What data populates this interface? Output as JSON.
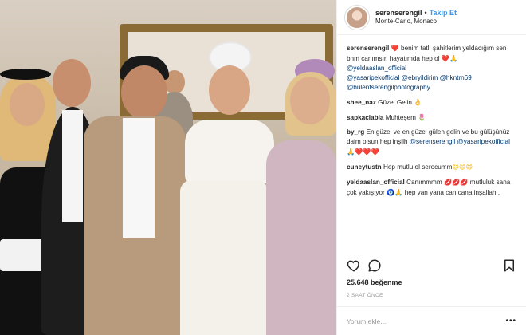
{
  "post": {
    "username": "serenserengil",
    "separator": "•",
    "follow_label": "Takip Et",
    "location": "Monte-Carlo, Monaco",
    "photo_alt": "wedding photo"
  },
  "caption": {
    "username": "serenserengil",
    "heart": "❤️",
    "text1": " benim tatlı şahitlerim yeldacığım sen bnm canımsın hayatımda hep ol ",
    "emoji1": "❤️🙏",
    "mention1": "@yeldaaslan_official",
    "mention2": "@yasaripekofficial",
    "mention3": "@ebryildirim",
    "mention4": "@hkntrn69",
    "mention5": "@bulentserengilphotography"
  },
  "comments": [
    {
      "user": "shee_naz",
      "text": " Güzel Gelin ",
      "emoji": "👌"
    },
    {
      "user": "sapkaciabla",
      "text": " Muhteşem ",
      "emoji": "🌷"
    },
    {
      "user": "by_rg",
      "text": " En güzel ve en güzel gülen gelin ve bu gülüşünüz daim olsun hep inşllh ",
      "mention1": "@serenserengil",
      "mention2": "@yasaripekofficial",
      "emoji": "🙏❤️❤️❤️"
    },
    {
      "user": "cuneytustn",
      "text": " Hep mutlu ol serocumm",
      "emoji": "😊😊😊"
    },
    {
      "user": "yeldaaslan_official",
      "text": " Canımmmm ",
      "emoji1": "💋💋💋",
      "text2": " mutluluk sana çok yakışıyor ",
      "emoji2": "🧿🙏",
      "text3": " hep yan yana can cana inşallah.."
    }
  ],
  "stats": {
    "likes": "25.648 beğenme",
    "time": "2 SAAT ÖNCE"
  },
  "comment_box": {
    "placeholder": "Yorum ekle...",
    "more": "•••"
  },
  "icons": {
    "like": "heart-outline-icon",
    "comment": "comment-bubble-icon",
    "save": "bookmark-icon"
  }
}
